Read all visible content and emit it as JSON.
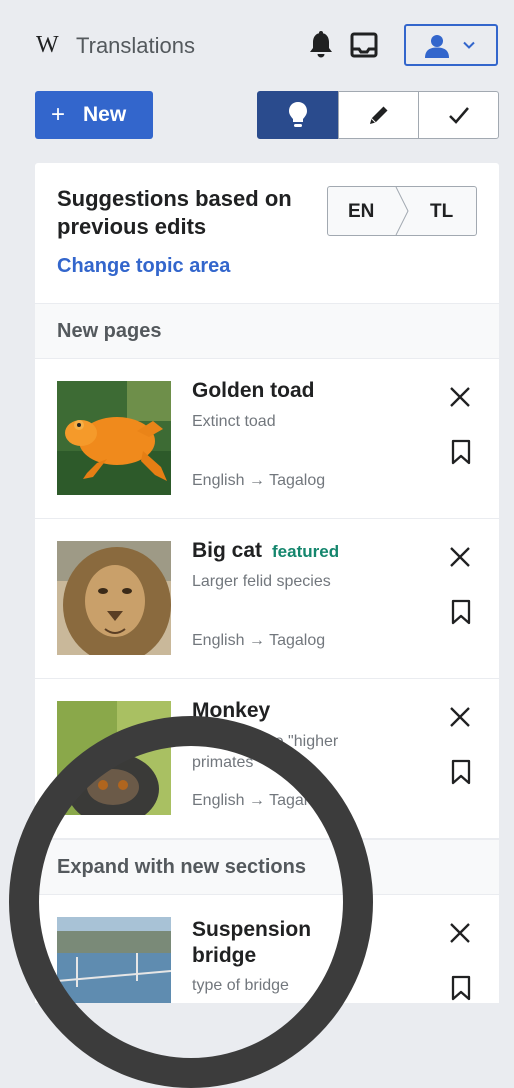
{
  "header": {
    "logo": "W",
    "title": "Translations",
    "icons": [
      "bell-icon",
      "inbox-icon",
      "user-icon",
      "chevron-down-icon"
    ]
  },
  "actions": {
    "new_plus": "+",
    "new_label": "New",
    "tabs": [
      "lightbulb-icon",
      "pencil-icon",
      "checkmark-icon"
    ]
  },
  "suggestions": {
    "title": "Suggestions based on previous edits",
    "change_topic": "Change topic area",
    "source_lang": "EN",
    "target_lang": "TL"
  },
  "sections": [
    {
      "heading": "New pages",
      "items": [
        {
          "title": "Golden toad",
          "badge": "",
          "description": "Extinct toad",
          "languages": "English → Tagalog"
        },
        {
          "title": "Big cat",
          "badge": "featured",
          "description": "Larger felid species",
          "languages": "English → Tagalog"
        },
        {
          "title": "Monkey",
          "badge": "",
          "description": "animal of the \"higher primates\"",
          "languages": "English → Tagalog"
        }
      ]
    },
    {
      "heading": "Expand with new sections",
      "items": [
        {
          "title": "Suspension bridge",
          "badge": "",
          "description": "type of bridge",
          "languages": ""
        }
      ]
    }
  ],
  "colors": {
    "accent": "#3366cc",
    "active_tab": "#2a4b8d",
    "featured": "#14866d",
    "background": "#eaecf0",
    "overlay_ring": "#3c3c3c"
  }
}
